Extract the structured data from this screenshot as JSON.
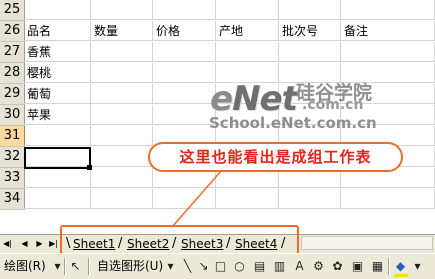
{
  "rows": [
    {
      "num": "25",
      "cells": [
        "",
        "",
        "",
        "",
        "",
        ""
      ]
    },
    {
      "num": "26",
      "cells": [
        "品名",
        "数量",
        "价格",
        "产地",
        "批次号",
        "备注"
      ]
    },
    {
      "num": "27",
      "cells": [
        "香蕉",
        "",
        "",
        "",
        "",
        ""
      ]
    },
    {
      "num": "28",
      "cells": [
        "樱桃",
        "",
        "",
        "",
        "",
        ""
      ]
    },
    {
      "num": "29",
      "cells": [
        "葡萄",
        "",
        "",
        "",
        "",
        ""
      ]
    },
    {
      "num": "30",
      "cells": [
        "苹果",
        "",
        "",
        "",
        "",
        ""
      ]
    },
    {
      "num": "31",
      "cells": [
        "",
        "",
        "",
        "",
        "",
        ""
      ]
    },
    {
      "num": "32",
      "cells": [
        "",
        "",
        "",
        "",
        "",
        ""
      ]
    },
    {
      "num": "33",
      "cells": [
        "",
        "",
        "",
        "",
        "",
        ""
      ]
    },
    {
      "num": "34",
      "cells": [
        "",
        "",
        "",
        "",
        "",
        ""
      ]
    }
  ],
  "selected_row": "31",
  "watermark": {
    "brand_e": "e",
    "brand_net": "Net",
    "brand_cn": "硅谷学院",
    "url_short": ".com.cn",
    "url_full": "School.eNet.com.cn"
  },
  "callout_text": "这里也能看出是成组工作表",
  "sheet_tabs": [
    "Sheet1",
    "Sheet2",
    "Sheet3",
    "Sheet4"
  ],
  "tab_nav": [
    "◀|",
    "◀",
    "▶",
    "▶|"
  ],
  "draw_toolbar": {
    "draw_label": "绘图(R)",
    "autoshape_label": "自选图形(U)",
    "accent_color": "#f26b2a",
    "callout_color": "#e4251a"
  }
}
